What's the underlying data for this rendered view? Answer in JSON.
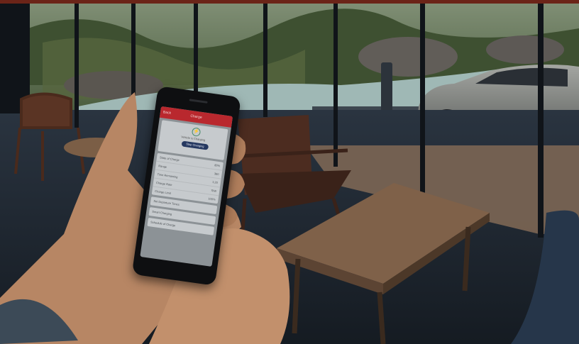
{
  "scene": {
    "description_tags": [
      "hands-holding-phone-icon",
      "electric-car-icon",
      "charging-post-icon"
    ]
  },
  "phone_app": {
    "back": "Back",
    "title": "Charge",
    "status": "Vehicle is Charging",
    "stop_button": "Stop Charging",
    "rows": [
      {
        "label": "State of Charge",
        "value": "80%"
      },
      {
        "label": "Range",
        "value": "360"
      },
      {
        "label": "Time Remaining",
        "value": "1:20"
      },
      {
        "label": "Charge Rate",
        "value": "7kW"
      },
      {
        "label": "Charge Limit",
        "value": "100%"
      },
      {
        "label": "Depart",
        "value": ""
      }
    ],
    "links": [
      "Set Departure Times",
      "Smart Charging",
      "Schedule of Charge"
    ]
  },
  "colors": {
    "app_bar": "#b9282e",
    "button": "#253860",
    "water": "#9fb8b5"
  }
}
